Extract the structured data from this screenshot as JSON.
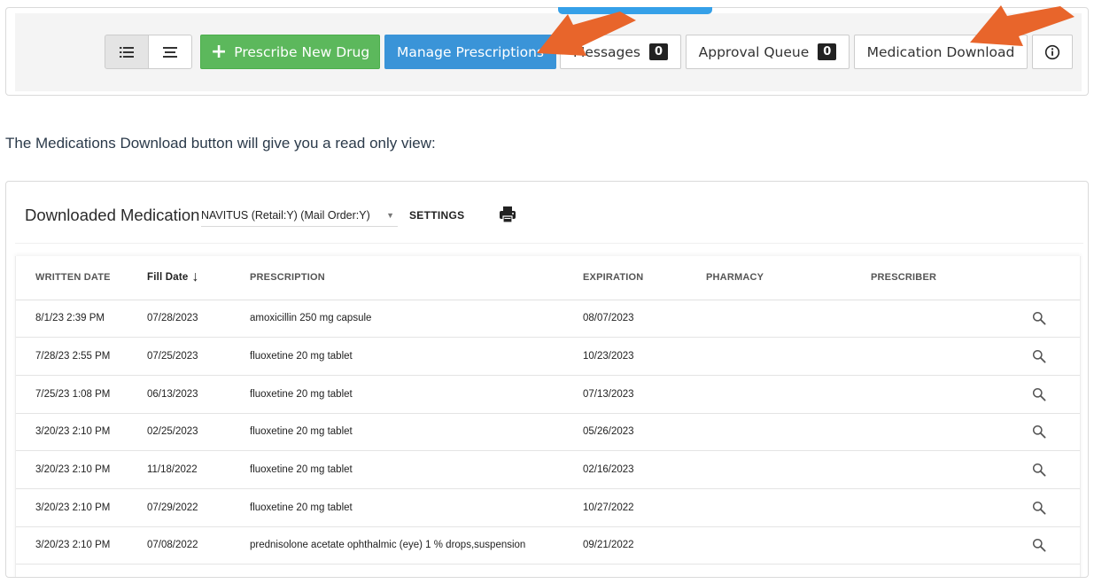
{
  "toolbar": {
    "view_list_icon": "list-view-icon",
    "view_compact_icon": "compact-list-icon",
    "prescribe_plus": "+",
    "prescribe_label": "Prescribe New Drug",
    "manage_label": "Manage Prescriptions",
    "messages_label": "Messages",
    "messages_count": "0",
    "approval_label": "Approval Queue",
    "approval_count": "0",
    "med_download_label": "Medication Download",
    "info_icon": "info-icon"
  },
  "colors": {
    "prescribe_green": "#5cb85c",
    "manage_blue": "#3a94d8",
    "arrow_orange": "#e8652b"
  },
  "intro_text": "The Medications Download button will give you a read only view:",
  "card": {
    "title": "Downloaded Medication",
    "plan_select_value": "NAVITUS (Retail:Y) (Mail Order:Y)",
    "settings_label": "SETTINGS",
    "print_icon": "print-icon"
  },
  "table": {
    "headers": {
      "written_date": "WRITTEN DATE",
      "fill_date": "Fill Date",
      "fill_sort": "↓",
      "prescription": "PRESCRIPTION",
      "expiration": "EXPIRATION",
      "pharmacy": "PHARMACY",
      "prescriber": "PRESCRIBER"
    },
    "rows": [
      {
        "written": "8/1/23 2:39 PM",
        "fill": "07/28/2023",
        "rx": "amoxicillin 250 mg capsule",
        "exp": "08/07/2023",
        "pharmacy": "",
        "prescriber": ""
      },
      {
        "written": "7/28/23 2:55 PM",
        "fill": "07/25/2023",
        "rx": "fluoxetine 20 mg tablet",
        "exp": "10/23/2023",
        "pharmacy": "",
        "prescriber": ""
      },
      {
        "written": "7/25/23 1:08 PM",
        "fill": "06/13/2023",
        "rx": "fluoxetine 20 mg tablet",
        "exp": "07/13/2023",
        "pharmacy": "",
        "prescriber": ""
      },
      {
        "written": "3/20/23 2:10 PM",
        "fill": "02/25/2023",
        "rx": "fluoxetine 20 mg tablet",
        "exp": "05/26/2023",
        "pharmacy": "",
        "prescriber": ""
      },
      {
        "written": "3/20/23 2:10 PM",
        "fill": "11/18/2022",
        "rx": "fluoxetine 20 mg tablet",
        "exp": "02/16/2023",
        "pharmacy": "",
        "prescriber": ""
      },
      {
        "written": "3/20/23 2:10 PM",
        "fill": "07/29/2022",
        "rx": "fluoxetine 20 mg tablet",
        "exp": "10/27/2022",
        "pharmacy": "",
        "prescriber": ""
      },
      {
        "written": "3/20/23 2:10 PM",
        "fill": "07/08/2022",
        "rx": "prednisolone acetate ophthalmic (eye) 1 % drops,suspension",
        "exp": "09/21/2022",
        "pharmacy": "",
        "prescriber": ""
      }
    ]
  }
}
